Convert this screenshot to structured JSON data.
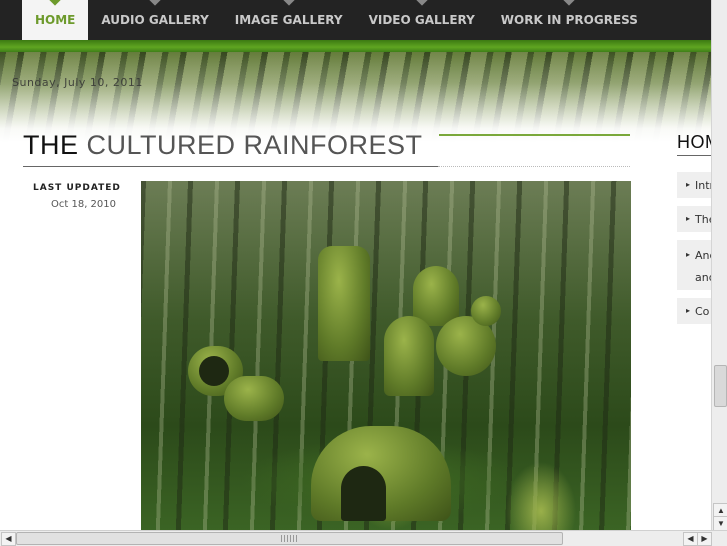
{
  "nav": {
    "items": [
      {
        "label": "HOME",
        "active": true
      },
      {
        "label": "AUDIO GALLERY",
        "active": false
      },
      {
        "label": "IMAGE GALLERY",
        "active": false
      },
      {
        "label": "VIDEO GALLERY",
        "active": false
      },
      {
        "label": "WORK IN PROGRESS",
        "active": false
      }
    ]
  },
  "banner": {
    "date": "Sunday, July 10, 2011"
  },
  "article": {
    "title_first": "THE",
    "title_rest": "CULTURED RAINFOREST",
    "last_updated_label": "LAST UPDATED",
    "last_updated_date": "Oct 18, 2010"
  },
  "sidebar": {
    "title": "HOME",
    "items": [
      {
        "label": "Intr"
      },
      {
        "label": "The"
      },
      {
        "label": "And",
        "line2": "and"
      },
      {
        "label": "Co"
      }
    ]
  },
  "colors": {
    "nav_bg": "#232323",
    "accent_green": "#6d9a2c",
    "green_bar": "#5fa521"
  },
  "icons": {
    "arrow": "▸",
    "scroll_up": "▲",
    "scroll_down": "▼",
    "scroll_left": "◀",
    "scroll_right": "▶"
  }
}
